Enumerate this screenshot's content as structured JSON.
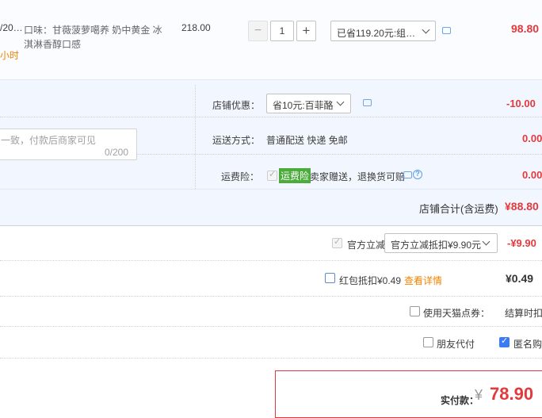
{
  "item": {
    "title_fragment": "/20…",
    "spec": "口味：甘薇菠萝噶养 奶中黄金 冰淇淋香醇口感",
    "spec_line1": "口味：甘薇菠萝噶养 奶中黄金 冰",
    "spec_line2": "淇淋香醇口感",
    "delivery_fragment": "小时",
    "unit_price": "218.00",
    "quantity": "1",
    "minus": "−",
    "plus": "+",
    "promo_select": "已省119.20元:组…",
    "subtotal": "98.80"
  },
  "shop": {
    "message_placeholder": "一致，付款后商家可见",
    "message_count": "0/200",
    "discount_label": "店铺优惠：",
    "discount_select": "省10元:百菲酪",
    "discount_amount": "-10.00",
    "shipping_label": "运送方式：",
    "shipping_value": "普通配送 快递 免邮",
    "shipping_amount": "0.00",
    "insurance_label": "运费险：",
    "insurance_badge": "运费险",
    "insurance_text": "卖家赠送，退换货可赔",
    "insurance_amount": "0.00",
    "total_label": "店铺合计(含运费)",
    "total_value": "¥88.80"
  },
  "official": {
    "label": "官方立减",
    "select": "官方立减抵扣¥9.90元",
    "amount": "-¥9.90"
  },
  "redpacket": {
    "label": "红包抵扣¥0.49",
    "link": "查看详情",
    "amount": "¥0.49"
  },
  "coupon": {
    "label": "使用天猫点券：",
    "note": "结算时扣除"
  },
  "friend": {
    "label": "朋友代付"
  },
  "anonymous": {
    "label": "匿名购买"
  },
  "payment": {
    "label": "实付款：",
    "currency": "¥",
    "amount": "78.90"
  },
  "colors": {
    "price_red": "#e4393c",
    "panel_bg": "#f2f7ff",
    "insurance_green": "#4bab3b",
    "link_orange": "#f08300",
    "checkbox_blue": "#3b7cf5"
  }
}
